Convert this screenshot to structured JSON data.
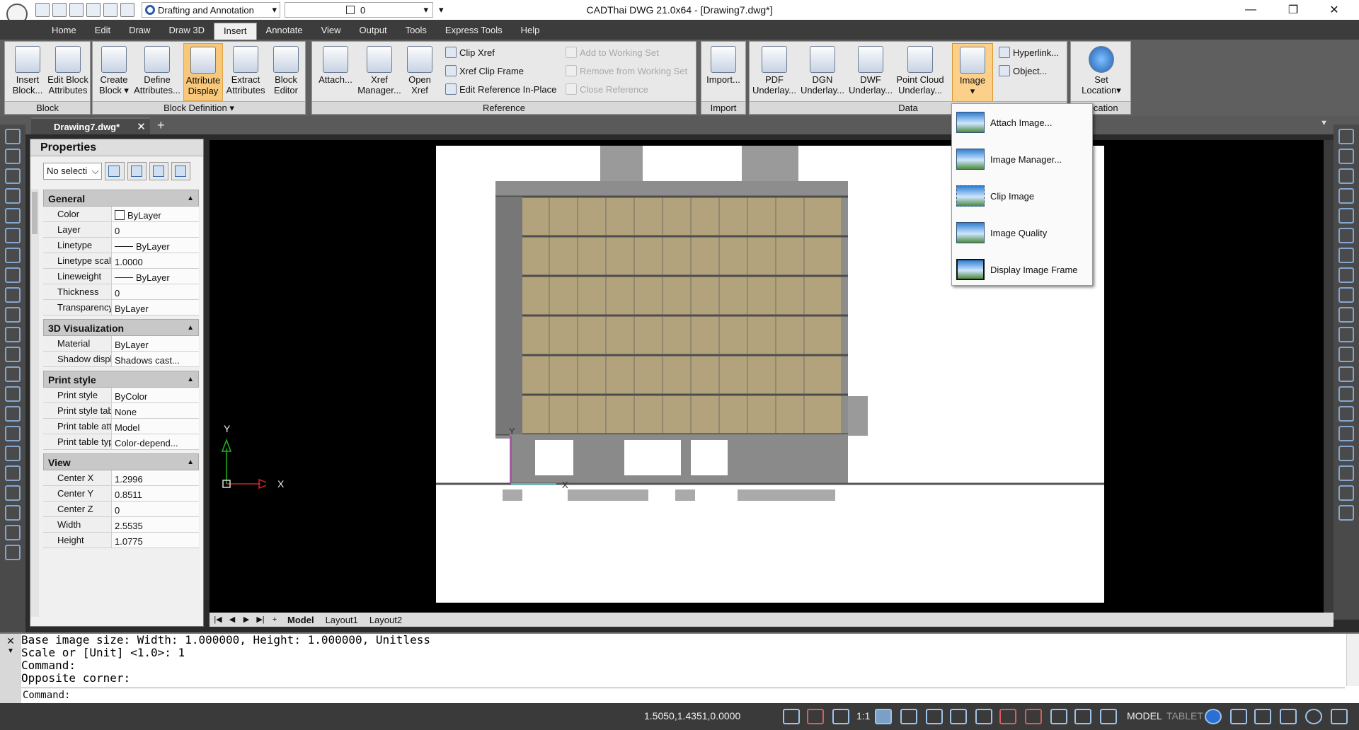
{
  "titlebar": {
    "workspace": "Drafting and Annotation",
    "layer": "0",
    "app_title": "CADThai DWG 21.0x64  - [Drawing7.dwg*]",
    "minimize": "—",
    "restore": "❐",
    "close": "✕"
  },
  "menu_tabs": [
    "Home",
    "Edit",
    "Draw",
    "Draw 3D",
    "Insert",
    "Annotate",
    "View",
    "Output",
    "Tools",
    "Express Tools",
    "Help"
  ],
  "ribbon": {
    "block": {
      "title": "Block",
      "insert": "Insert\nBlock...",
      "edit_attr": "Edit Block\nAttributes"
    },
    "block_def": {
      "title": "Block Definition ▾",
      "create": "Create\nBlock ▾",
      "define": "Define\nAttributes...",
      "attr_display": "Attribute\nDisplay",
      "extract": "Extract\nAttributes",
      "editor": "Block\nEditor"
    },
    "reference": {
      "title": "Reference",
      "attach": "Attach...",
      "xref_mgr": "Xref\nManager...",
      "open_xref": "Open\nXref",
      "clip_xref": "Clip Xref",
      "xref_clip_frame": "Xref Clip Frame",
      "edit_ref": "Edit Reference In-Place",
      "add_ws": "Add to Working Set",
      "remove_ws": "Remove from Working Set",
      "close_ref": "Close Reference"
    },
    "import": {
      "title": "Import",
      "import_btn": "Import..."
    },
    "data": {
      "title": "Data",
      "pdf": "PDF\nUnderlay...",
      "dgn": "DGN\nUnderlay...",
      "dwf": "DWF\nUnderlay...",
      "pointcloud": "Point Cloud\nUnderlay...",
      "image": "Image",
      "hyperlink": "Hyperlink...",
      "object": "Object..."
    },
    "location": {
      "title": "Location",
      "set_location": "Set\nLocation▾"
    }
  },
  "doc_tab": {
    "name": "Drawing7.dwg*",
    "close": "✕",
    "add": "+"
  },
  "properties": {
    "title": "Properties",
    "selection": "No selecti",
    "groups": [
      {
        "name": "General",
        "rows": [
          {
            "k": "Color",
            "v": "ByLayer"
          },
          {
            "k": "Layer",
            "v": "0"
          },
          {
            "k": "Linetype",
            "v": "ByLayer"
          },
          {
            "k": "Linetype scale",
            "v": "1.0000"
          },
          {
            "k": "Lineweight",
            "v": "ByLayer"
          },
          {
            "k": "Thickness",
            "v": "0"
          },
          {
            "k": "Transparency",
            "v": "ByLayer"
          }
        ]
      },
      {
        "name": "3D Visualization",
        "rows": [
          {
            "k": "Material",
            "v": "ByLayer"
          },
          {
            "k": "Shadow displ...",
            "v": "Shadows cast..."
          }
        ]
      },
      {
        "name": "Print style",
        "rows": [
          {
            "k": "Print style",
            "v": "ByColor"
          },
          {
            "k": "Print style table",
            "v": "None"
          },
          {
            "k": "Print table att...",
            "v": "Model"
          },
          {
            "k": "Print table type",
            "v": "Color-depend..."
          }
        ]
      },
      {
        "name": "View",
        "rows": [
          {
            "k": "Center X",
            "v": "1.2996"
          },
          {
            "k": "Center Y",
            "v": "0.8511"
          },
          {
            "k": "Center Z",
            "v": "0"
          },
          {
            "k": "Width",
            "v": "2.5535"
          },
          {
            "k": "Height",
            "v": "1.0775"
          }
        ]
      }
    ]
  },
  "canvas": {
    "ucs_x": "X",
    "ucs_y": "Y",
    "sheet_x": "X",
    "sheet_y": "Y"
  },
  "layout_tabs": [
    "Model",
    "Layout1",
    "Layout2"
  ],
  "image_menu": [
    "Attach Image...",
    "Image Manager...",
    "Clip Image",
    "Image Quality",
    "Display Image Frame"
  ],
  "command": {
    "history": "Base image size: Width: 1.000000, Height: 1.000000, Unitless\nScale or [Unit] <1.0>: 1\nCommand:\nOpposite corner:",
    "prompt": "Command:"
  },
  "status": {
    "coords": "1.5050,1.4351,0.0000",
    "scale": "1:1",
    "model": "MODEL",
    "tablet": "TABLET"
  },
  "colors": {
    "accent": "#f7c77a",
    "ucs_red": "#d22222",
    "ucs_green": "#22b422",
    "building": "#b8a77a"
  }
}
